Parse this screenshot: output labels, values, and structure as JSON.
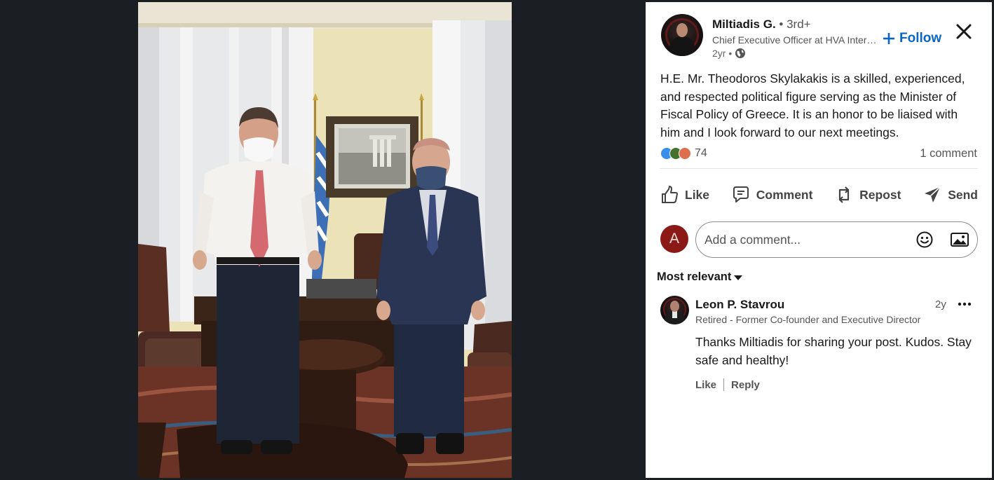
{
  "post": {
    "author_name": "Miltiadis G.",
    "author_degree": "• 3rd+",
    "author_title": "Chief Executive Officer at HVA International Group",
    "time": "2yr •",
    "follow_label": "Follow",
    "text": "H.E. Mr. Theodoros Skylakakis is a skilled, experienced, and respected political figure serving as the Minister of Fiscal Policy of Greece. It is an honor to be liaised with him and I look forward to our next meetings.",
    "reaction_count": "74",
    "comment_count": "1 comment"
  },
  "actions": {
    "like": "Like",
    "comment": "Comment",
    "repost": "Repost",
    "send": "Send"
  },
  "composer": {
    "avatar_initial": "A",
    "placeholder": "Add a comment..."
  },
  "sort_label": "Most relevant",
  "comment": {
    "author_name": "Leon P. Stavrou",
    "time": "2y",
    "headline": "Retired - Former Co-founder and Executive Director",
    "text": "Thanks Miltiadis for sharing your post. Kudos. Stay safe and healthy!",
    "like_label": "Like",
    "reply_label": "Reply"
  },
  "colors": {
    "accent": "#0a66c2",
    "me_avatar": "#8b1a17",
    "reaction_like": "#378fe9",
    "reaction_celebrate": "#44712e",
    "reaction_love": "#df704d"
  }
}
